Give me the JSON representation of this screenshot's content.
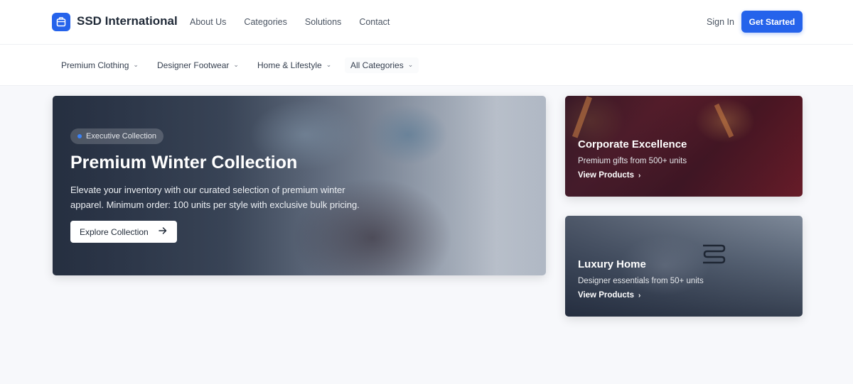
{
  "header": {
    "brand": "SSD International",
    "nav": [
      "About Us",
      "Categories",
      "Solutions",
      "Contact"
    ],
    "signin": "Sign In",
    "cta": "Get Started"
  },
  "categories": [
    {
      "label": "Premium Clothing"
    },
    {
      "label": "Designer Footwear"
    },
    {
      "label": "Home & Lifestyle"
    },
    {
      "label": "All Categories"
    }
  ],
  "hero": {
    "badge": "Executive Collection",
    "title": "Premium Winter Collection",
    "description": "Elevate your inventory with our curated selection of premium winter apparel. Minimum order: 100 units per style with exclusive bulk pricing.",
    "button": "Explore Collection"
  },
  "cards": [
    {
      "title": "Corporate Excellence",
      "subtitle": "Premium gifts from 500+ units",
      "link": "View Products"
    },
    {
      "title": "Luxury Home",
      "subtitle": "Designer essentials from 50+ units",
      "link": "View Products"
    }
  ],
  "colors": {
    "accent": "#2563eb"
  },
  "icons": {
    "logo": "package-icon",
    "chevron": "chevron-down-icon",
    "arrow": "arrow-right-icon"
  }
}
